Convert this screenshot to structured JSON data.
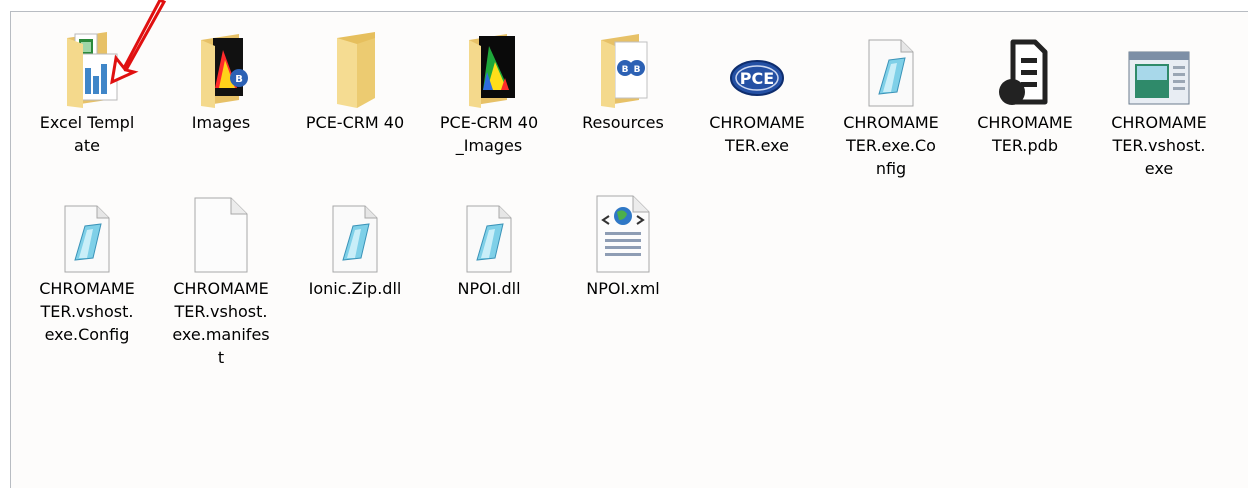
{
  "files": [
    {
      "name": "Excel Template",
      "icon": "excel-template-folder-icon",
      "kind": "folder"
    },
    {
      "name": "Images",
      "icon": "images-folder-icon",
      "kind": "folder"
    },
    {
      "name": "PCE-CRM 40",
      "icon": "folder-icon",
      "kind": "folder"
    },
    {
      "name": "PCE-CRM 40_Images",
      "icon": "images-folder-icon",
      "kind": "folder"
    },
    {
      "name": "Resources",
      "icon": "resources-folder-icon",
      "kind": "folder"
    },
    {
      "name": "CHROMAMETER.exe",
      "icon": "pce-app-icon",
      "kind": "file"
    },
    {
      "name": "CHROMAMETER.exe.Config",
      "icon": "config-file-icon",
      "kind": "file"
    },
    {
      "name": "CHROMAMETER.pdb",
      "icon": "pdb-file-icon",
      "kind": "file"
    },
    {
      "name": "CHROMAMETER.vshost.exe",
      "icon": "window-app-icon",
      "kind": "file"
    },
    {
      "name": "CHROMAMETER.vshost.exe.Config",
      "icon": "config-file-icon",
      "kind": "file"
    },
    {
      "name": "CHROMAMETER.vshost.exe.manifest",
      "icon": "blank-file-icon",
      "kind": "file"
    },
    {
      "name": "Ionic.Zip.dll",
      "icon": "dll-file-icon",
      "kind": "file"
    },
    {
      "name": "NPOI.dll",
      "icon": "dll-file-icon",
      "kind": "file"
    },
    {
      "name": "NPOI.xml",
      "icon": "xml-file-icon",
      "kind": "file"
    }
  ],
  "annotation": {
    "icon": "red-arrow-icon"
  },
  "colors": {
    "folder": "#f1d27e",
    "arrow": "#e01010",
    "pane_border": "#b8bcc2"
  },
  "icons": {
    "pce_logo_text": "PCE"
  }
}
